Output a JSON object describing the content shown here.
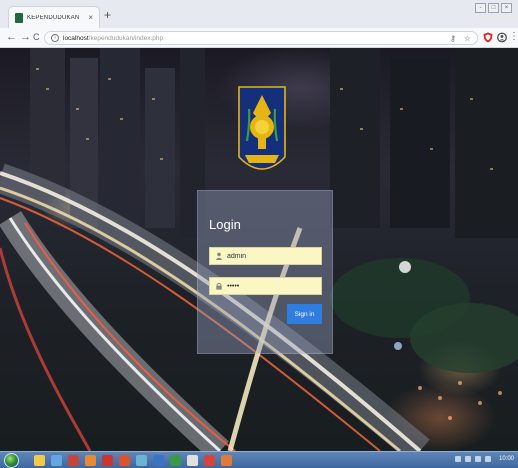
{
  "browser": {
    "tab_title": "KEPENDUDUKAN",
    "tab_close": "×",
    "new_tab": "+",
    "url_host": "localhost",
    "url_path": "/kependudukan/index.php",
    "nav": {
      "back": "←",
      "forward": "→",
      "reload": "C"
    },
    "window_controls": [
      "-",
      "□",
      "×"
    ]
  },
  "login": {
    "title": "Login",
    "username_value": "admin",
    "password_value": "•••••",
    "signin_label": "Sign in"
  },
  "taskbar": {
    "clock": "10:00"
  },
  "colors": {
    "accent": "#2f7de1",
    "field_bg": "#fbf7c4",
    "emblem_blue": "#14307a",
    "emblem_gold": "#e7b416"
  }
}
